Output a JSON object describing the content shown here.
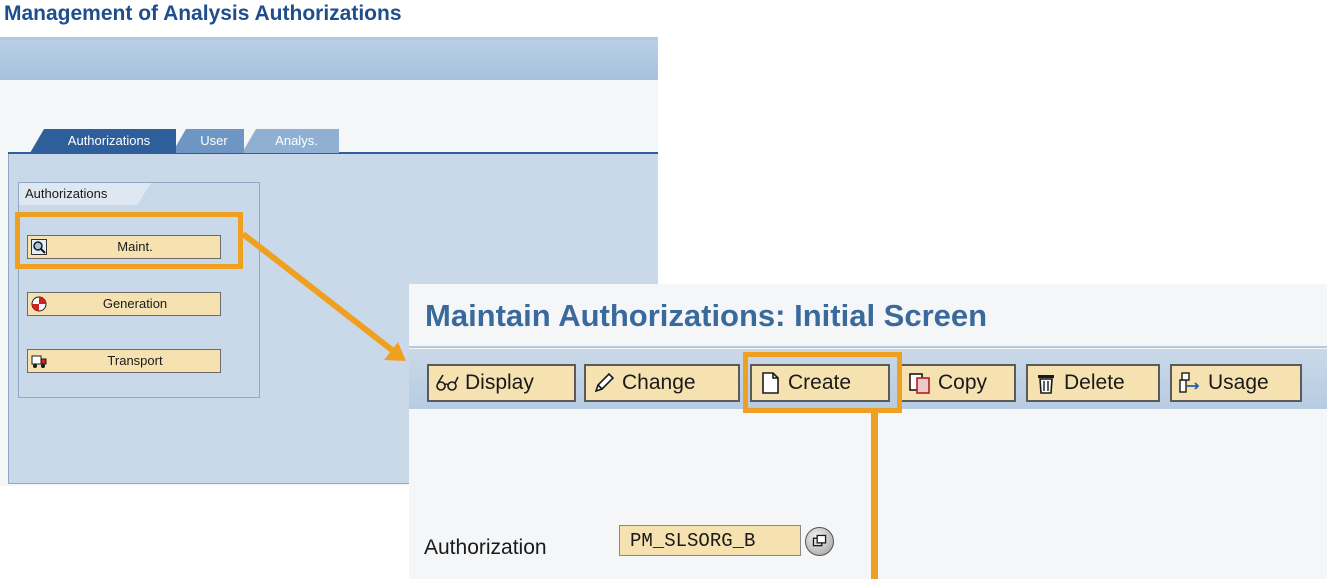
{
  "screen1": {
    "title": "Management of Analysis Authorizations",
    "tabs": [
      {
        "label": "Authorizations",
        "active": true
      },
      {
        "label": "User",
        "active": false
      },
      {
        "label": "Analys.",
        "active": false
      }
    ],
    "group": {
      "label": "Authorizations",
      "buttons": [
        {
          "label": "Maint.",
          "icon": "display-glasses-icon",
          "highlighted": true
        },
        {
          "label": "Generation",
          "icon": "generate-target-icon"
        },
        {
          "label": "Transport",
          "icon": "truck-icon"
        }
      ]
    }
  },
  "screen2": {
    "title": "Maintain Authorizations: Initial Screen",
    "toolbar": [
      {
        "label": "Display",
        "icon": "glasses-icon"
      },
      {
        "label": "Change",
        "icon": "pencil-icon"
      },
      {
        "label": "Create",
        "icon": "blank-page-icon",
        "highlighted": true
      },
      {
        "label": "Copy",
        "icon": "copy-icon"
      },
      {
        "label": "Delete",
        "icon": "trash-icon"
      },
      {
        "label": "Usage",
        "icon": "where-used-icon"
      }
    ],
    "authorization": {
      "label": "Authorization",
      "value": "PM_SLSORG_B"
    }
  },
  "colors": {
    "highlight": "#f0a020",
    "title_blue": "#1f4e8c",
    "button_fill": "#f5e2b0",
    "panel_blue": "#c9d9e9"
  }
}
